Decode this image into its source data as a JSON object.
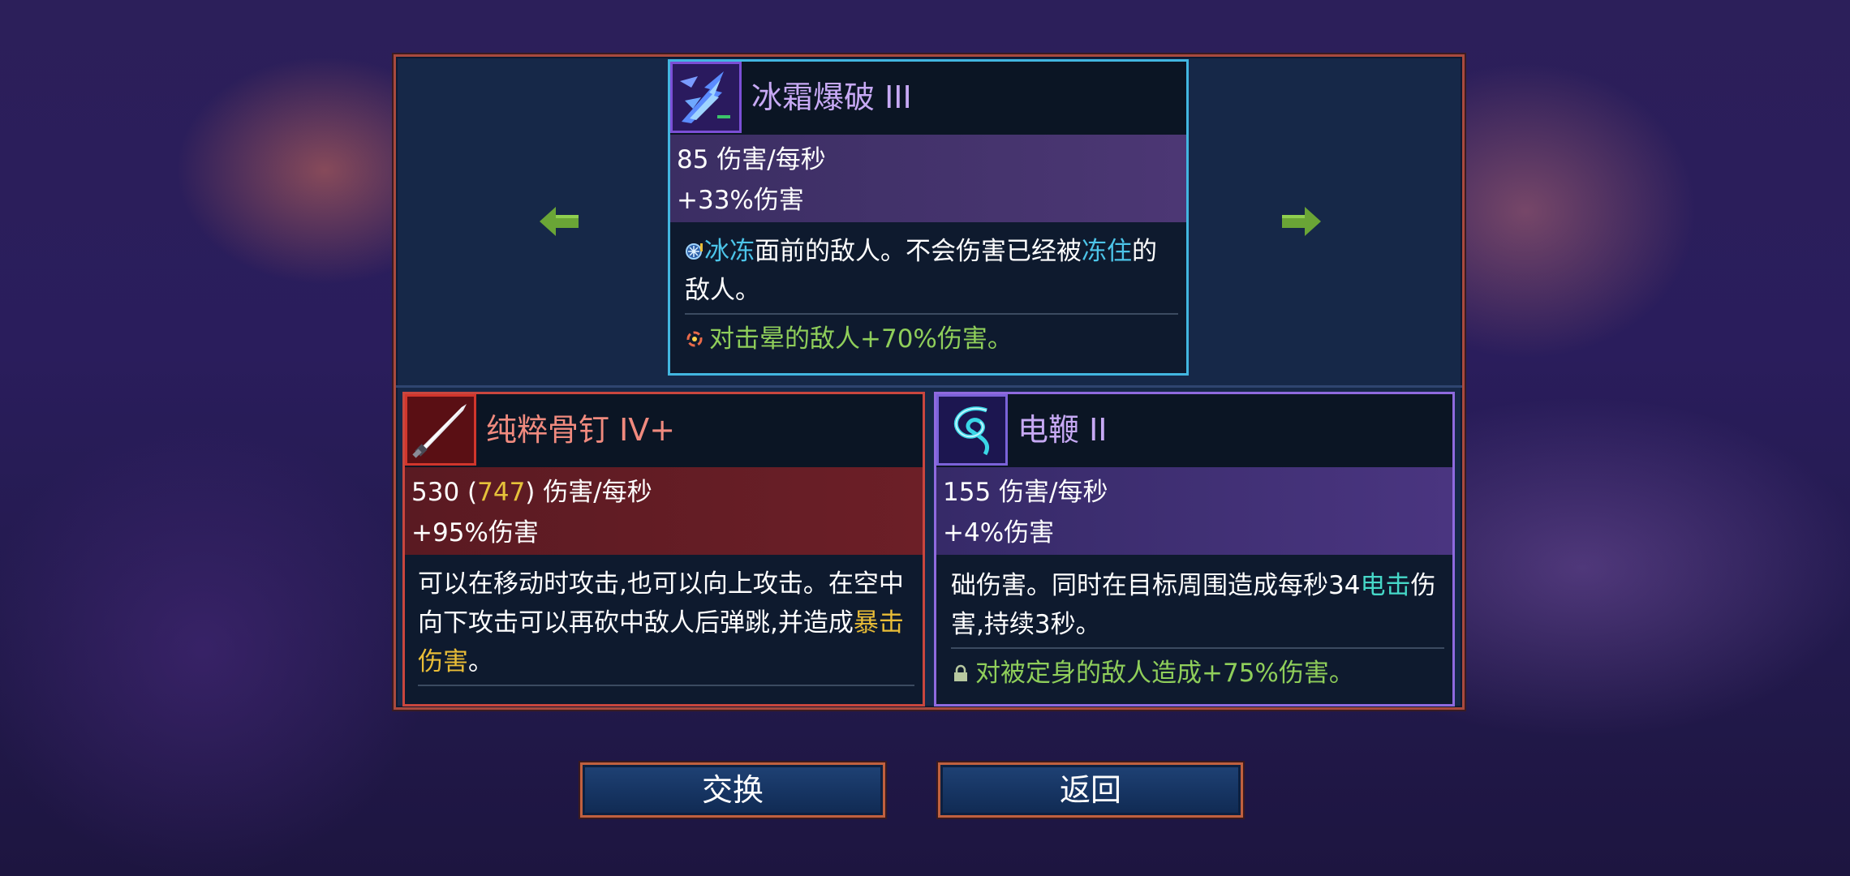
{
  "top_card": {
    "title": "冰霜爆破 III",
    "icon": "frost-blast-icon",
    "stat_dps": "85 伤害/每秒",
    "stat_bonus": "+33%伤害",
    "desc_1": "冰冻",
    "desc_2": "面前的敌人。不会伤害已经被",
    "desc_3": "冻住",
    "desc_4": "的敌人。",
    "bonus": "对击晕的敌人+70%伤害。"
  },
  "left_card": {
    "title": "纯粹骨钉 IV+",
    "icon": "nail-sword-icon",
    "stat_dps_a": "530 (",
    "stat_dps_b": "747",
    "stat_dps_c": ") 伤害/每秒",
    "stat_bonus": "+95%伤害",
    "desc_1": "可以在移动时攻击,也可以向上攻击。在空中向下攻击可以再砍中敌人后弹跳,并造成",
    "desc_2": "暴击伤害",
    "desc_3": "。"
  },
  "right_card": {
    "title": "电鞭 II",
    "icon": "electric-whip-icon",
    "stat_dps": "155 伤害/每秒",
    "stat_bonus": "+4%伤害",
    "desc_1": "础伤害。同时在目标周围造成每秒34",
    "desc_2": "电击",
    "desc_3": "伤害,持续3秒。",
    "bonus": "对被定身的敌人造成+75%伤害。"
  },
  "buttons": {
    "swap": "交换",
    "back": "返回"
  },
  "colors": {
    "frame": "#a94a3e",
    "top_border": "#42b6e0",
    "left_border": "#c9463e",
    "right_border": "#8f6adf",
    "arrow": "#6aa536"
  }
}
